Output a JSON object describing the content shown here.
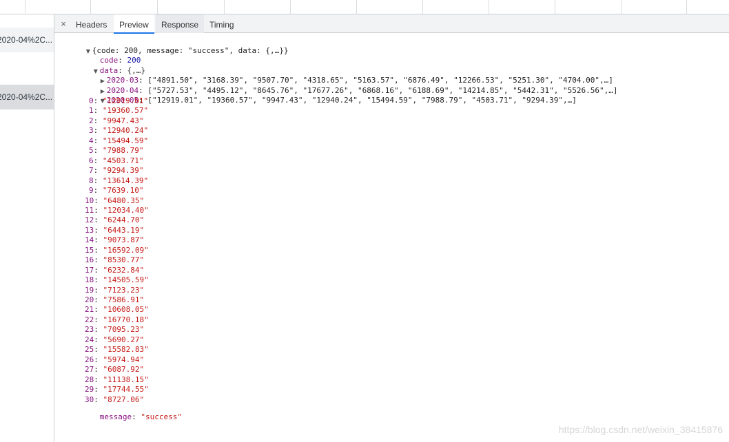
{
  "request_list": {
    "items": [
      {
        "label": "2020-04%2C..."
      },
      {
        "label": "2020-04%2C..."
      }
    ]
  },
  "tabs": [
    {
      "label": "Headers"
    },
    {
      "label": "Preview"
    },
    {
      "label": "Response"
    },
    {
      "label": "Timing"
    }
  ],
  "close_glyph": "×",
  "preview": {
    "root_summary": "{code: 200, message: \"success\", data: {,…}}",
    "code_key": "code",
    "code_value": "200",
    "data_key": "data",
    "data_summary": "{,…}",
    "months": [
      {
        "key": "2020-03",
        "summary": "[\"4891.50\", \"3168.39\", \"9507.70\", \"4318.65\", \"5163.57\", \"6876.49\", \"12266.53\", \"5251.30\", \"4704.00\",…]"
      },
      {
        "key": "2020-04",
        "summary": "[\"5727.53\", \"4495.12\", \"8645.76\", \"17677.26\", \"6868.16\", \"6188.69\", \"14214.85\", \"5442.31\", \"5526.56\",…]"
      },
      {
        "key": "2020-05",
        "summary": "[\"12919.01\", \"19360.57\", \"9947.43\", \"12940.24\", \"15494.59\", \"7988.79\", \"4503.71\", \"9294.39\",…]"
      }
    ],
    "may_values": [
      "12919.01",
      "19360.57",
      "9947.43",
      "12940.24",
      "15494.59",
      "7988.79",
      "4503.71",
      "9294.39",
      "13614.39",
      "7639.10",
      "6480.35",
      "12034.40",
      "6244.70",
      "6443.19",
      "9073.87",
      "16592.09",
      "8530.77",
      "6232.84",
      "14505.59",
      "7123.23",
      "7586.91",
      "10608.05",
      "16770.18",
      "7095.23",
      "5690.27",
      "15582.83",
      "5974.94",
      "6087.92",
      "11138.15",
      "17744.55",
      "8727.06"
    ],
    "message_key": "message",
    "message_value": "success"
  },
  "watermark": "https://blog.csdn.net/weixin_38415876"
}
